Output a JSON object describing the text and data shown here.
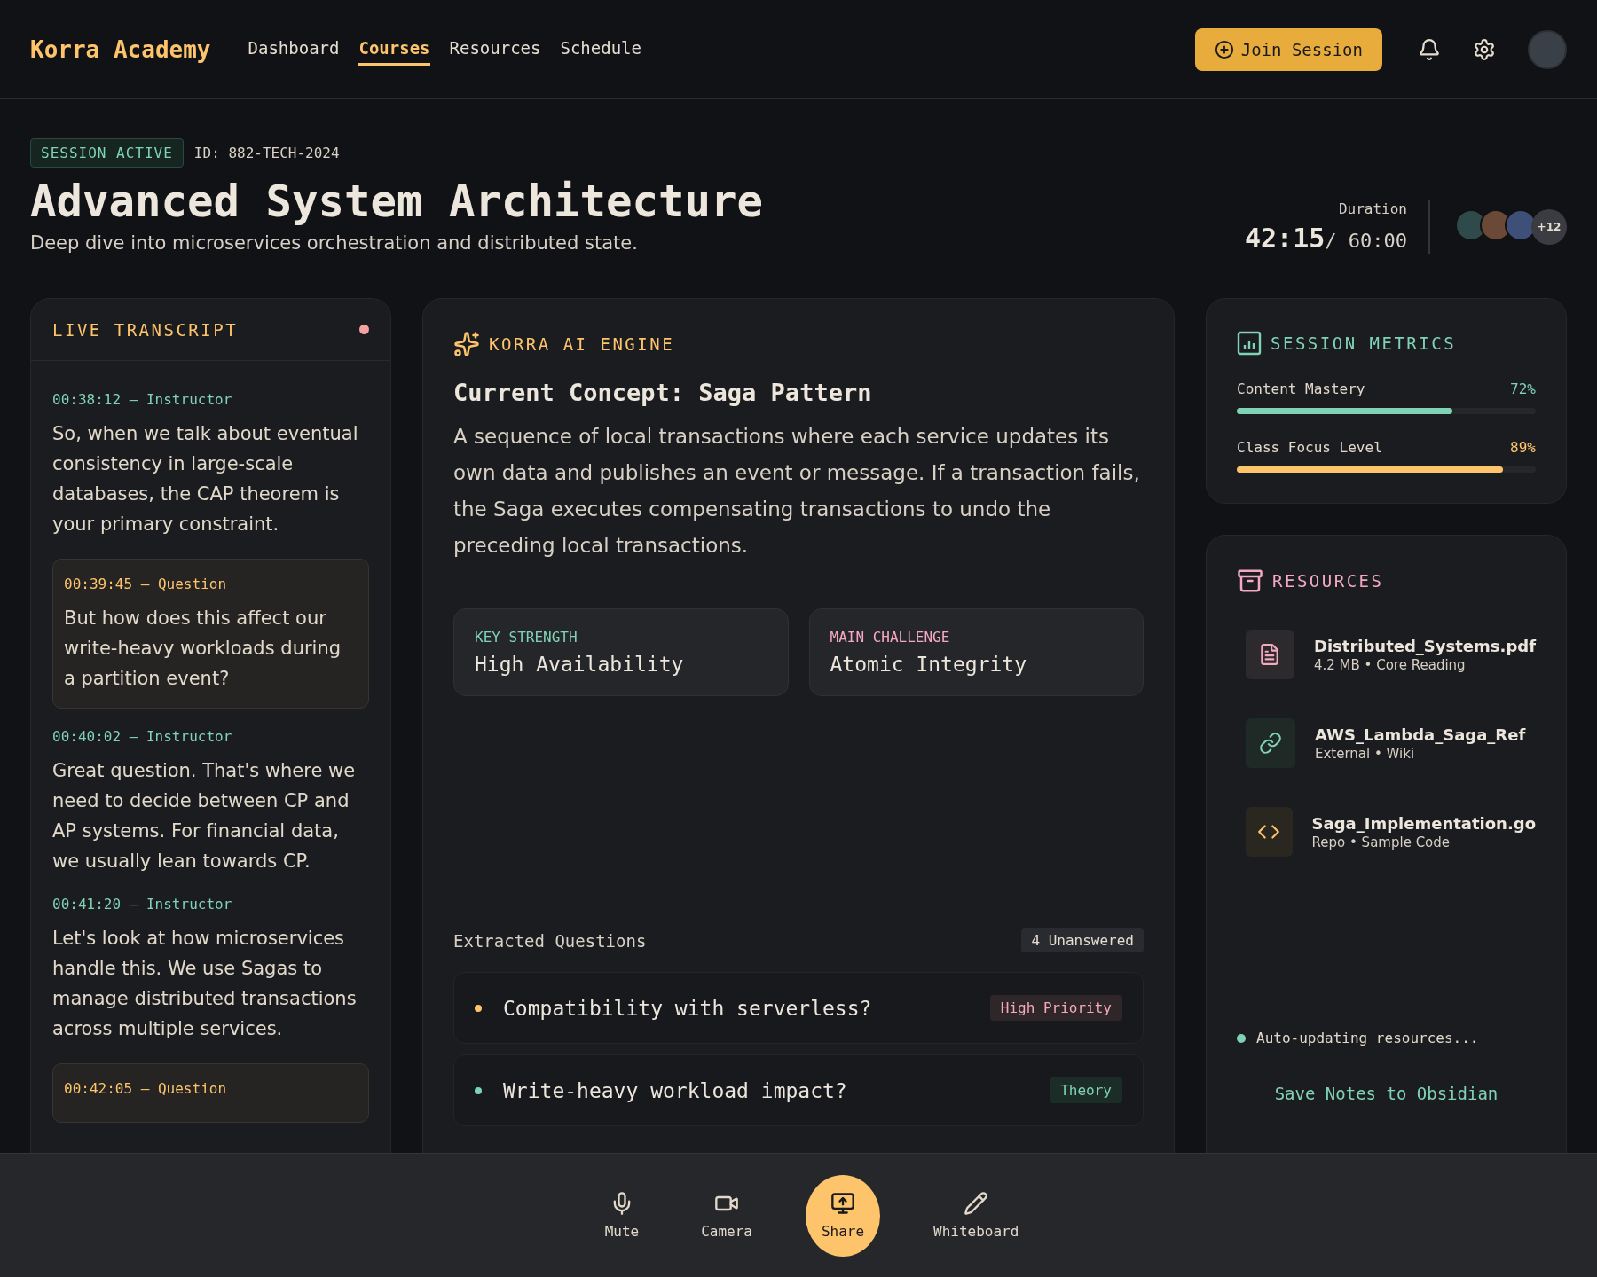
{
  "header": {
    "logo": "Korra Academy",
    "nav": [
      {
        "label": "Dashboard",
        "selected": false
      },
      {
        "label": "Courses",
        "selected": true
      },
      {
        "label": "Resources",
        "selected": false
      },
      {
        "label": "Schedule",
        "selected": false
      }
    ],
    "join_button": "Join Session"
  },
  "session": {
    "status": "SESSION ACTIVE",
    "id": "ID: 882-TECH-2024",
    "title": "Advanced System Architecture",
    "subtitle": "Deep dive into microservices orchestration and distributed state.",
    "duration_label": "Duration",
    "elapsed": "42:15",
    "total": "/ 60:00",
    "extra_participants": "+12"
  },
  "transcript": {
    "title": "LIVE TRANSCRIPT",
    "entries": [
      {
        "kind": "instructor",
        "meta": "00:38:12 — Instructor",
        "text": "So, when we talk about eventual consistency in large-scale databases, the CAP theorem is your primary constraint."
      },
      {
        "kind": "question",
        "meta": "00:39:45 — Question",
        "text": "But how does this affect our write-heavy workloads during a partition event?"
      },
      {
        "kind": "instructor",
        "meta": "00:40:02 — Instructor",
        "text": "Great question. That's where we need to decide between CP and AP systems. For financial data, we usually lean towards CP."
      },
      {
        "kind": "instructor",
        "meta": "00:41:20 — Instructor",
        "text": "Let's look at how microservices handle this. We use Sagas to manage distributed transactions across multiple services."
      },
      {
        "kind": "question",
        "meta": "00:42:05 — Question"
      }
    ]
  },
  "ai_engine": {
    "title": "KORRA AI ENGINE",
    "concept": "Current Concept: Saga Pattern",
    "description": "A sequence of local transactions where each service updates its own data and publishes an event or message. If a transaction fails, the Saga executes compensating transactions to undo the preceding local transactions.",
    "facts": [
      {
        "kind": "strength",
        "label": "KEY STRENGTH",
        "value": "High Availability"
      },
      {
        "kind": "challenge",
        "label": "MAIN CHALLENGE",
        "value": "Atomic Integrity"
      }
    ],
    "questions_title": "Extracted Questions",
    "unanswered": "4 Unanswered",
    "questions": [
      {
        "text": "Compatibility with serverless?",
        "color": "#fdc46b",
        "tag": {
          "kind": "priority",
          "label": "High Priority"
        }
      },
      {
        "text": "Write-heavy workload impact?",
        "color": "#7fd3b4",
        "tag": {
          "kind": "theory",
          "label": "Theory"
        }
      }
    ]
  },
  "metrics": {
    "title": "SESSION METRICS",
    "items": [
      {
        "label": "Content Mastery",
        "reading": "72%",
        "level": 0.72,
        "color": "#7fd3b4"
      },
      {
        "label": "Class Focus Level",
        "reading": "89%",
        "level": 0.89,
        "color": "#fdc46b"
      }
    ]
  },
  "resources": {
    "title": "RESOURCES",
    "items": [
      {
        "kind": "file",
        "name": "Distributed_Systems.pdf",
        "meta": "4.2 MB • Core Reading"
      },
      {
        "kind": "link",
        "name": "AWS_Lambda_Saga_Ref",
        "meta": "External • Wiki"
      },
      {
        "kind": "code",
        "name": "Saga_Implementation.go",
        "meta": "Repo • Sample Code"
      }
    ],
    "status": "Auto-updating resources...",
    "save_link": "Save Notes to Obsidian"
  },
  "controls": [
    {
      "kind": "mic",
      "label": "Mute",
      "selected": false
    },
    {
      "kind": "camera",
      "label": "Camera",
      "selected": false
    },
    {
      "kind": "share",
      "label": "Share",
      "selected": true
    },
    {
      "kind": "whiteboard",
      "label": "Whiteboard",
      "selected": false
    }
  ]
}
